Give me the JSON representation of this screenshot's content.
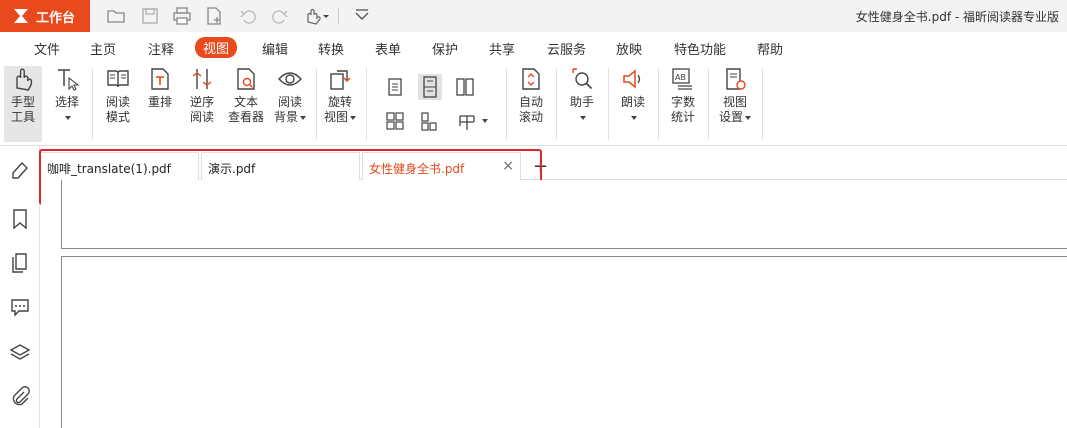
{
  "titlebar": {
    "workbench_label": "工作台",
    "doc_title": "女性健身全书.pdf - 福昕阅读器专业版",
    "accent": "#e8491d"
  },
  "menu": {
    "items": [
      "文件",
      "主页",
      "注释",
      "视图",
      "编辑",
      "转换",
      "表单",
      "保护",
      "共享",
      "云服务",
      "放映",
      "特色功能",
      "帮助"
    ],
    "active": "视图"
  },
  "ribbon": {
    "hand_tool": "手型\n工具",
    "hand_tool_l1": "手型",
    "hand_tool_l2": "工具",
    "select": "选择",
    "read_mode_l1": "阅读",
    "read_mode_l2": "模式",
    "reflow": "重排",
    "reverse_l1": "逆序",
    "reverse_l2": "阅读",
    "text_viewer_l1": "文本",
    "text_viewer_l2": "查看器",
    "read_bg_l1": "阅读",
    "read_bg_l2": "背景",
    "rotate_l1": "旋转",
    "rotate_l2": "视图",
    "auto_scroll_l1": "自动",
    "auto_scroll_l2": "滚动",
    "assistant": "助手",
    "read_aloud": "朗读",
    "word_count_l1": "字数",
    "word_count_l2": "统计",
    "view_settings_l1": "视图",
    "view_settings_l2": "设置"
  },
  "tabs": [
    {
      "label": "咖啡_translate(1).pdf",
      "active": false
    },
    {
      "label": "演示.pdf",
      "active": false
    },
    {
      "label": "女性健身全书.pdf",
      "active": true
    }
  ],
  "tab_close": "×",
  "tab_add": "+",
  "icons": {
    "left_panel": [
      "eraser-icon",
      "bookmark-icon",
      "pages-icon",
      "comments-icon",
      "layers-icon",
      "attachment-icon"
    ]
  }
}
